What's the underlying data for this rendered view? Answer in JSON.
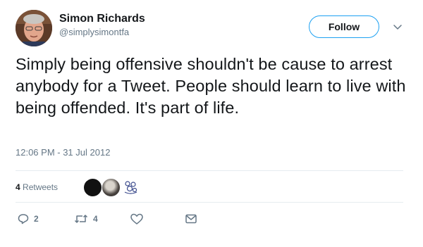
{
  "user": {
    "name": "Simon Richards",
    "handle": "@simplysimontfa"
  },
  "follow_label": "Follow",
  "tweet": {
    "text": "Simply being offensive shouldn't be cause to arrest anybody for a Tweet. People should learn to live with being offended. It's part of life.",
    "timestamp": "12:06 PM - 31 Jul 2012"
  },
  "retweets": {
    "count": "4",
    "label": "Retweets"
  },
  "actions": {
    "reply_count": "2",
    "retweet_count": "4"
  },
  "colors": {
    "accent": "#1da1f2",
    "secondary_text": "#657786",
    "divider": "#e6ecf0"
  },
  "icons": [
    "reply-icon",
    "retweet-icon",
    "like-icon",
    "message-icon",
    "chevron-down-icon"
  ]
}
